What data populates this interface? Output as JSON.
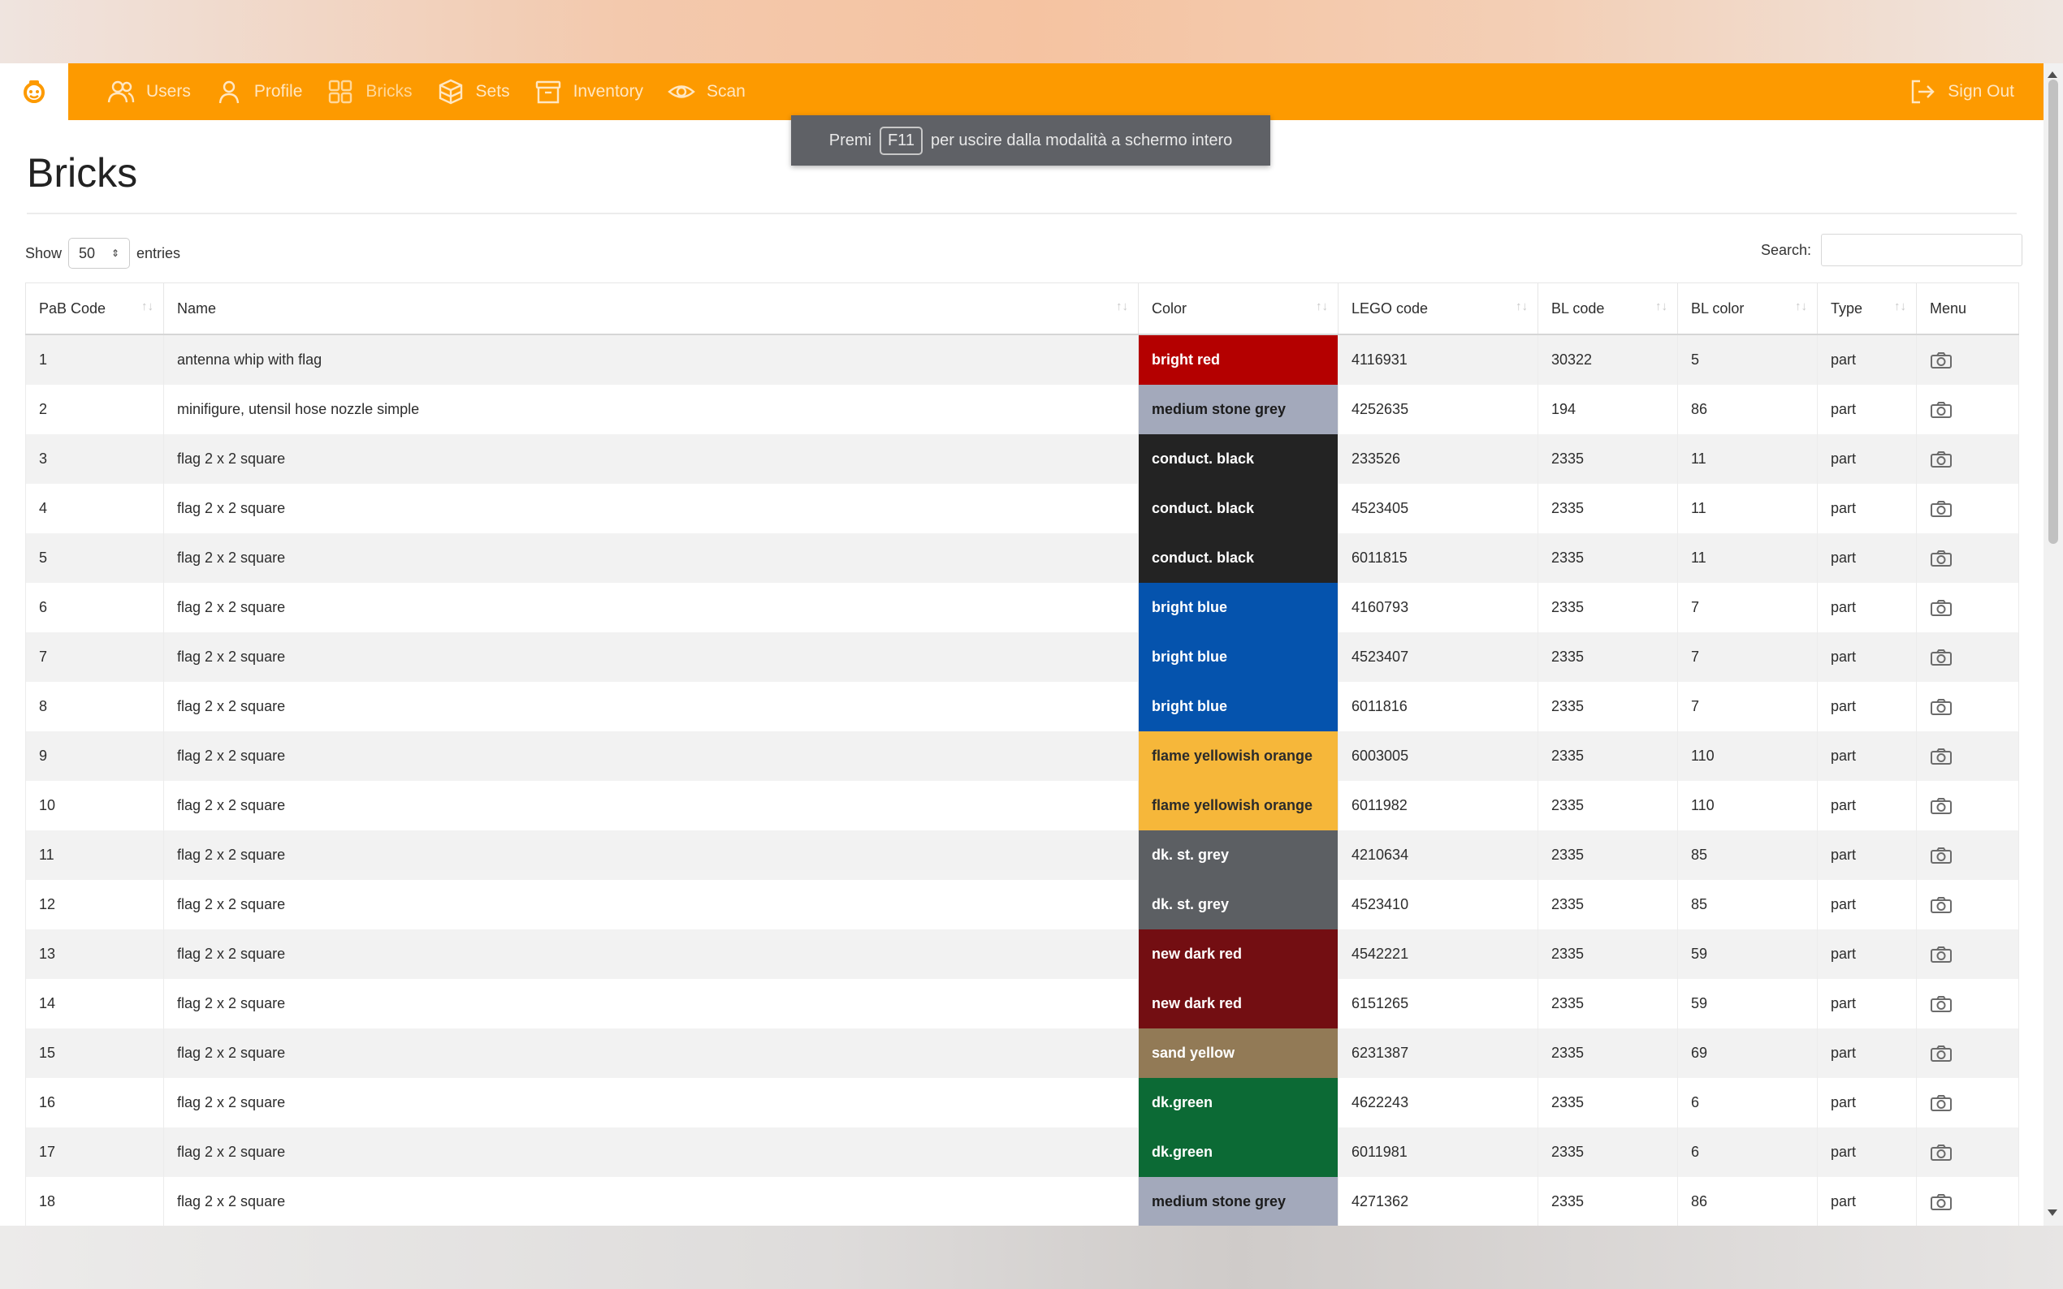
{
  "nav": {
    "items": [
      {
        "label": "Users",
        "icon": "users-icon"
      },
      {
        "label": "Profile",
        "icon": "profile-icon"
      },
      {
        "label": "Bricks",
        "icon": "grid-icon"
      },
      {
        "label": "Sets",
        "icon": "box-icon"
      },
      {
        "label": "Inventory",
        "icon": "archive-icon"
      },
      {
        "label": "Scan",
        "icon": "eye-icon"
      }
    ],
    "signout": "Sign Out",
    "active": "Bricks",
    "bg_color": "#fd9a00"
  },
  "toast": {
    "before": "Premi",
    "key": "F11",
    "after": "per uscire dalla modalità a schermo intero"
  },
  "page": {
    "title": "Bricks"
  },
  "controls": {
    "show": "Show",
    "entries_value": "50",
    "entries": "entries",
    "search_label": "Search:"
  },
  "table": {
    "headers": [
      "PaB Code",
      "Name",
      "Color",
      "LEGO code",
      "BL code",
      "BL color",
      "Type",
      "Menu"
    ],
    "rows": [
      {
        "pab": "1",
        "name": "antenna whip with flag",
        "color": "bright red",
        "color_bg": "#b40000",
        "color_fg": "#ffffff",
        "lego": "4116931",
        "bl_code": "30322",
        "bl_color": "5",
        "type": "part"
      },
      {
        "pab": "2",
        "name": "minifigure, utensil hose nozzle simple",
        "color": "medium stone grey",
        "color_bg": "#a3a9bb",
        "color_fg": "#1c1c1c",
        "lego": "4252635",
        "bl_code": "194",
        "bl_color": "86",
        "type": "part"
      },
      {
        "pab": "3",
        "name": "flag 2 x 2 square",
        "color": "conduct. black",
        "color_bg": "#232323",
        "color_fg": "#ffffff",
        "lego": "233526",
        "bl_code": "2335",
        "bl_color": "11",
        "type": "part"
      },
      {
        "pab": "4",
        "name": "flag 2 x 2 square",
        "color": "conduct. black",
        "color_bg": "#232323",
        "color_fg": "#ffffff",
        "lego": "4523405",
        "bl_code": "2335",
        "bl_color": "11",
        "type": "part"
      },
      {
        "pab": "5",
        "name": "flag 2 x 2 square",
        "color": "conduct. black",
        "color_bg": "#232323",
        "color_fg": "#ffffff",
        "lego": "6011815",
        "bl_code": "2335",
        "bl_color": "11",
        "type": "part"
      },
      {
        "pab": "6",
        "name": "flag 2 x 2 square",
        "color": "bright blue",
        "color_bg": "#0553ad",
        "color_fg": "#ffffff",
        "lego": "4160793",
        "bl_code": "2335",
        "bl_color": "7",
        "type": "part"
      },
      {
        "pab": "7",
        "name": "flag 2 x 2 square",
        "color": "bright blue",
        "color_bg": "#0553ad",
        "color_fg": "#ffffff",
        "lego": "4523407",
        "bl_code": "2335",
        "bl_color": "7",
        "type": "part"
      },
      {
        "pab": "8",
        "name": "flag 2 x 2 square",
        "color": "bright blue",
        "color_bg": "#0553ad",
        "color_fg": "#ffffff",
        "lego": "6011816",
        "bl_code": "2335",
        "bl_color": "7",
        "type": "part"
      },
      {
        "pab": "9",
        "name": "flag 2 x 2 square",
        "color": "flame yellowish orange",
        "color_bg": "#f6b73a",
        "color_fg": "#2b2b2b",
        "lego": "6003005",
        "bl_code": "2335",
        "bl_color": "110",
        "type": "part"
      },
      {
        "pab": "10",
        "name": "flag 2 x 2 square",
        "color": "flame yellowish orange",
        "color_bg": "#f6b73a",
        "color_fg": "#2b2b2b",
        "lego": "6011982",
        "bl_code": "2335",
        "bl_color": "110",
        "type": "part"
      },
      {
        "pab": "11",
        "name": "flag 2 x 2 square",
        "color": "dk. st. grey",
        "color_bg": "#5c5f63",
        "color_fg": "#ffffff",
        "lego": "4210634",
        "bl_code": "2335",
        "bl_color": "85",
        "type": "part"
      },
      {
        "pab": "12",
        "name": "flag 2 x 2 square",
        "color": "dk. st. grey",
        "color_bg": "#5c5f63",
        "color_fg": "#ffffff",
        "lego": "4523410",
        "bl_code": "2335",
        "bl_color": "85",
        "type": "part"
      },
      {
        "pab": "13",
        "name": "flag 2 x 2 square",
        "color": "new dark red",
        "color_bg": "#730e12",
        "color_fg": "#ffffff",
        "lego": "4542221",
        "bl_code": "2335",
        "bl_color": "59",
        "type": "part"
      },
      {
        "pab": "14",
        "name": "flag 2 x 2 square",
        "color": "new dark red",
        "color_bg": "#730e12",
        "color_fg": "#ffffff",
        "lego": "6151265",
        "bl_code": "2335",
        "bl_color": "59",
        "type": "part"
      },
      {
        "pab": "15",
        "name": "flag 2 x 2 square",
        "color": "sand yellow",
        "color_bg": "#927a56",
        "color_fg": "#ffffff",
        "lego": "6231387",
        "bl_code": "2335",
        "bl_color": "69",
        "type": "part"
      },
      {
        "pab": "16",
        "name": "flag 2 x 2 square",
        "color": "dk.green",
        "color_bg": "#0c6a35",
        "color_fg": "#ffffff",
        "lego": "4622243",
        "bl_code": "2335",
        "bl_color": "6",
        "type": "part"
      },
      {
        "pab": "17",
        "name": "flag 2 x 2 square",
        "color": "dk.green",
        "color_bg": "#0c6a35",
        "color_fg": "#ffffff",
        "lego": "6011981",
        "bl_code": "2335",
        "bl_color": "6",
        "type": "part"
      },
      {
        "pab": "18",
        "name": "flag 2 x 2 square",
        "color": "medium stone grey",
        "color_bg": "#a3a9bb",
        "color_fg": "#1c1c1c",
        "lego": "4271362",
        "bl_code": "2335",
        "bl_color": "86",
        "type": "part"
      }
    ]
  }
}
